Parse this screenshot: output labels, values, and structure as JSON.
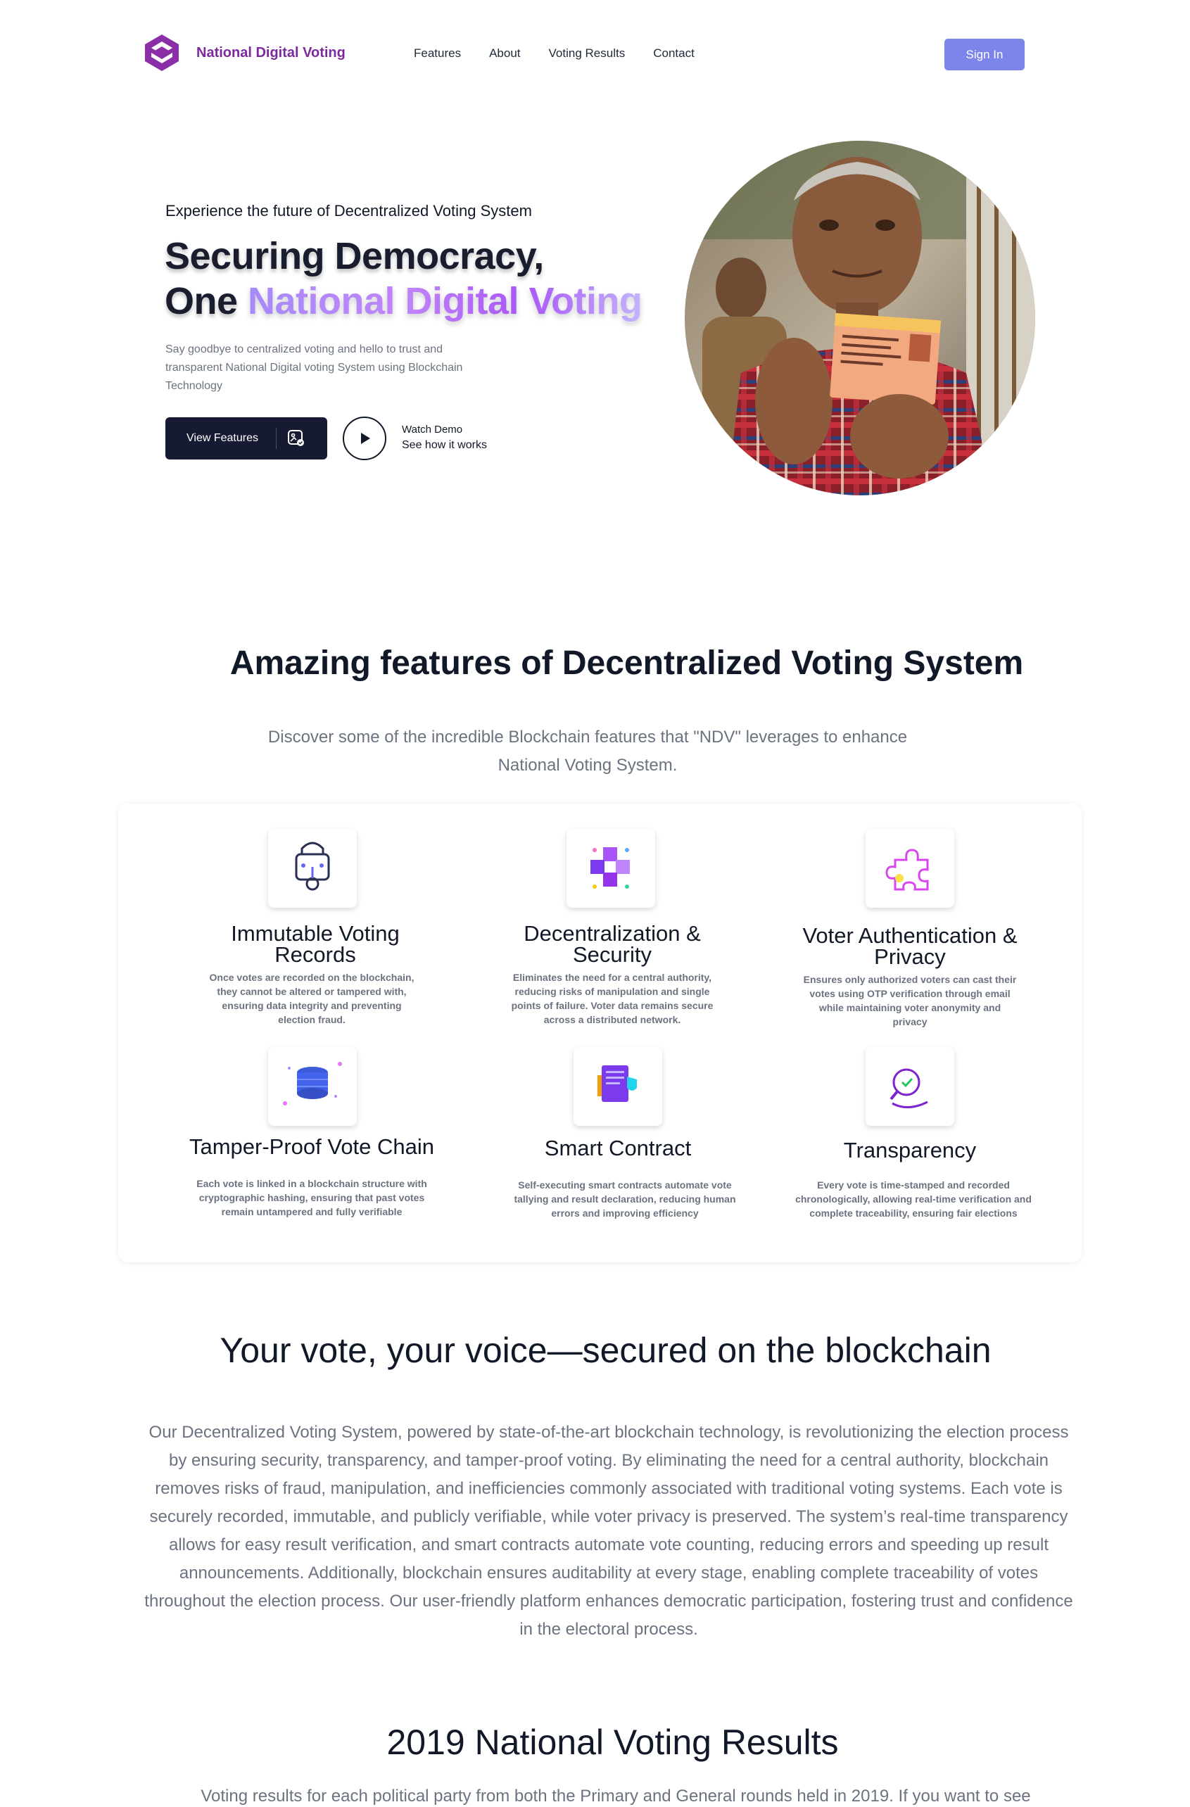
{
  "nav": {
    "brand": "National Digital Voting",
    "links": [
      "Features",
      "About",
      "Voting Results",
      "Contact"
    ],
    "signin": "Sign In"
  },
  "hero": {
    "eyebrow": "Experience the future of Decentralized Voting System",
    "title_line1": "Securing Democracy,",
    "title_line2_prefix": "One ",
    "title_line2_highlight": "National Digital Voting",
    "subtitle": "Say goodbye to centralized voting and hello to trust and transparent National Digital voting System using Blockchain Technology",
    "features_button": "View Features",
    "demo_title": "Watch Demo",
    "demo_sub": "See how it works"
  },
  "features": {
    "title": "Amazing features of Decentralized Voting System",
    "subtitle": "Discover some of the incredible Blockchain features that \"NDV\" leverages to enhance National Voting System.",
    "items": [
      {
        "title": "Immutable Voting Records",
        "desc": "Once votes are recorded on the blockchain, they cannot be altered or tampered with, ensuring data integrity and preventing election fraud.",
        "icon": "lock-icon"
      },
      {
        "title": "Decentralization & Security",
        "desc": "Eliminates the need for a central authority, reducing risks of manipulation and single points of failure. Voter data remains secure across a distributed network.",
        "icon": "blocks-icon"
      },
      {
        "title": "Voter Authentication & Privacy",
        "desc": "Ensures only authorized voters can cast their votes using OTP verification through email while maintaining voter anonymity and privacy",
        "icon": "puzzle-icon"
      },
      {
        "title": "Tamper-Proof Vote Chain",
        "desc": "Each vote is linked in a blockchain structure with cryptographic hashing, ensuring that past votes remain untampered and fully verifiable",
        "icon": "database-icon"
      },
      {
        "title": "Smart Contract",
        "desc": "Self-executing smart contracts automate vote tallying and result declaration, reducing human errors and improving efficiency",
        "icon": "contract-icon"
      },
      {
        "title": "Transparency",
        "desc": "Every vote is time-stamped and recorded chronologically, allowing real-time verification and complete traceability, ensuring fair elections",
        "icon": "magnifier-icon"
      }
    ]
  },
  "about": {
    "title": "Your vote, your voice—secured on the blockchain",
    "body": "Our Decentralized Voting System, powered by state-of-the-art blockchain technology, is revolutionizing the election process by ensuring security, transparency, and tamper-proof voting. By eliminating the need for a central authority, blockchain removes risks of fraud, manipulation, and inefficiencies commonly associated with traditional voting systems. Each vote is securely recorded, immutable, and publicly verifiable, while voter privacy is preserved. The system’s real-time transparency allows for easy result verification, and smart contracts automate vote counting, reducing errors and speeding up result announcements. Additionally, blockchain ensures auditability at every stage, enabling complete traceability of votes throughout the election process. Our user-friendly platform enhances democratic participation, fostering trust and confidence in the electoral process."
  },
  "results": {
    "title": "2019 National Voting Results",
    "body": "Voting results for each political party from both the Primary and General rounds held in 2019. If you want to see"
  },
  "colors": {
    "brand": "#7b2a9e",
    "signin": "#7c86ea",
    "dark_button": "#161b33",
    "muted_text": "#6b7280"
  }
}
